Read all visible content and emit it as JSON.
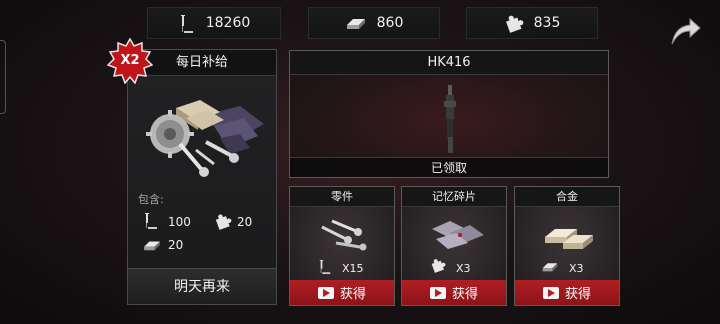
{
  "resources": {
    "screws": {
      "value": "18260",
      "icon": "screw-icon"
    },
    "alloy": {
      "value": "860",
      "icon": "alloy-ingot-icon"
    },
    "fragments": {
      "value": "835",
      "icon": "puzzle-piece-icon"
    }
  },
  "daily_supply": {
    "title": "每日补给",
    "multiplier": "X2",
    "contains_label": "包含:",
    "contents": [
      {
        "icon": "screw-icon",
        "amount": "100"
      },
      {
        "icon": "puzzle-piece-icon",
        "amount": "20"
      },
      {
        "icon": "alloy-ingot-icon",
        "amount": "20"
      }
    ],
    "button_label": "明天再来"
  },
  "weapon": {
    "name": "HK416",
    "status": "已领取"
  },
  "reward_cards": [
    {
      "title": "零件",
      "icon": "screw-icon",
      "qty": "X15",
      "button_label": "获得"
    },
    {
      "title": "记忆碎片",
      "icon": "puzzle-piece-icon",
      "qty": "X3",
      "button_label": "获得"
    },
    {
      "title": "合金",
      "icon": "alloy-ingot-icon",
      "qty": "X3",
      "button_label": "获得"
    }
  ],
  "colors": {
    "accent_red": "#b01e22",
    "panel": "#1f1f20"
  }
}
